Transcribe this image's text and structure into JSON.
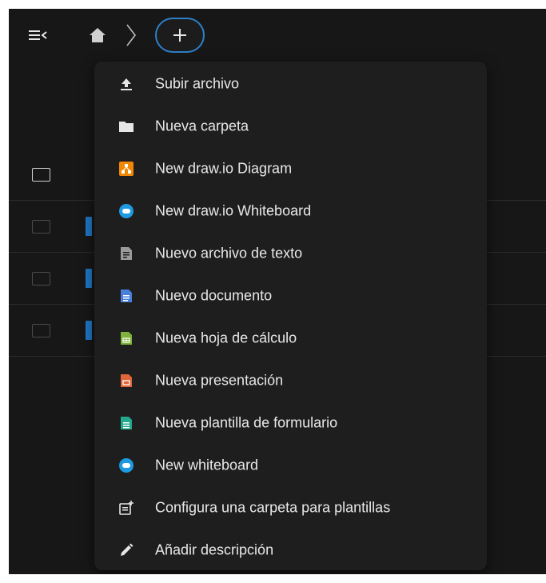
{
  "header": {
    "sidebar_toggle_icon": "sidebar-collapse-icon",
    "home_icon": "home-icon",
    "separator_icon": "chevron-right-icon",
    "new_button_label": "+",
    "accent_color": "#2d7fc9"
  },
  "new_menu": {
    "items": [
      {
        "label": "Subir archivo",
        "icon": "upload-icon"
      },
      {
        "label": "Nueva carpeta",
        "icon": "folder-icon"
      },
      {
        "label": "New draw.io Diagram",
        "icon": "drawio-diagram-icon",
        "color": "#f08705"
      },
      {
        "label": "New draw.io Whiteboard",
        "icon": "drawio-whiteboard-icon",
        "color": "#1e9be0"
      },
      {
        "label": "Nuevo archivo de texto",
        "icon": "text-file-icon"
      },
      {
        "label": "Nuevo documento",
        "icon": "document-icon",
        "color": "#4a7fdc"
      },
      {
        "label": "Nueva hoja de cálculo",
        "icon": "spreadsheet-icon",
        "color": "#7fb23a"
      },
      {
        "label": "Nueva presentación",
        "icon": "presentation-icon",
        "color": "#e0663a"
      },
      {
        "label": "Nueva plantilla de formulario",
        "icon": "form-template-icon",
        "color": "#24a88c"
      },
      {
        "label": "New whiteboard",
        "icon": "whiteboard-icon",
        "color": "#1e9be0"
      },
      {
        "label": "Configura una carpeta para plantillas",
        "icon": "template-folder-icon"
      },
      {
        "label": "Añadir descripción",
        "icon": "pencil-icon"
      }
    ]
  }
}
